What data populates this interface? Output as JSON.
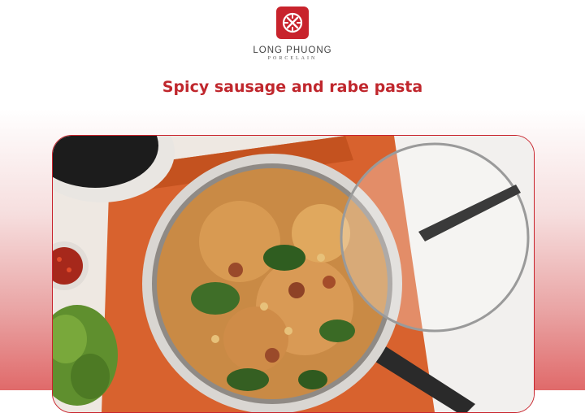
{
  "brand": {
    "name": "LONG PHUONG",
    "subtitle": "PORCELAIN",
    "logo_icon": "long-phuong-logo-icon",
    "accent_color": "#c8232c"
  },
  "recipe": {
    "title": "Spicy sausage and rabe pasta"
  },
  "photo": {
    "icon": "pasta-pan-photo"
  }
}
